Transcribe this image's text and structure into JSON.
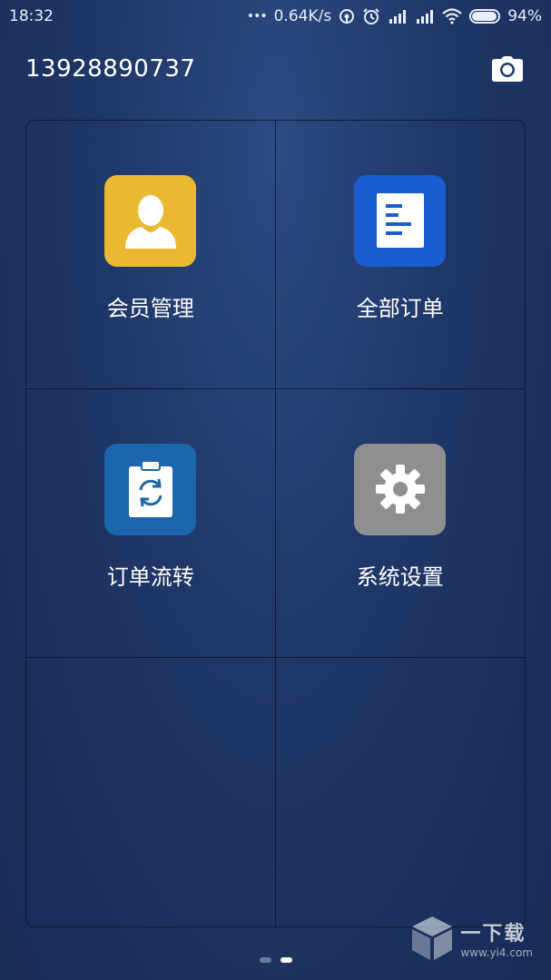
{
  "status_bar": {
    "time": "18:32",
    "dots": "•••",
    "net_speed": "0.64K/s",
    "battery_percent": "94%",
    "battery_level": 0.94
  },
  "header": {
    "phone_number": "13928890737"
  },
  "menu": {
    "items": [
      {
        "label": "会员管理",
        "color": "#eab931",
        "icon": "person-icon"
      },
      {
        "label": "全部订单",
        "color": "#1a5dd0",
        "icon": "document-icon"
      },
      {
        "label": "订单流转",
        "color": "#1c66ad",
        "icon": "clipboard-refresh-icon"
      },
      {
        "label": "系统设置",
        "color": "#8f8f8f",
        "icon": "gear-icon"
      }
    ]
  },
  "pager": {
    "pages": 2,
    "current": 2
  },
  "watermark": {
    "title": "一下载",
    "url": "www.yi4.com"
  }
}
